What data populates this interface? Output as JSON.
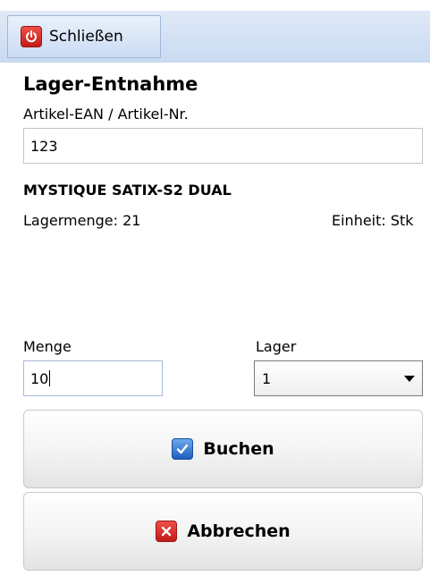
{
  "toolbar": {
    "close_label": "Schließen"
  },
  "form": {
    "title": "Lager-Entnahme",
    "article_label": "Artikel-EAN / Artikel-Nr.",
    "article_value": "123",
    "product_name": "MYSTIQUE SATIX-S2 DUAL",
    "stock_text": "Lagermenge: 21",
    "unit_text": "Einheit: Stk",
    "quantity_label": "Menge",
    "quantity_value": "10",
    "warehouse_label": "Lager",
    "warehouse_value": "1"
  },
  "buttons": {
    "book_label": "Buchen",
    "cancel_label": "Abbrechen"
  },
  "icons": {
    "close": "power-icon",
    "book": "check-icon",
    "cancel": "x-icon"
  },
  "colors": {
    "toolbar_bg": "#c9daf2",
    "power_red": "#d8302b",
    "check_blue": "#2f6fce"
  }
}
